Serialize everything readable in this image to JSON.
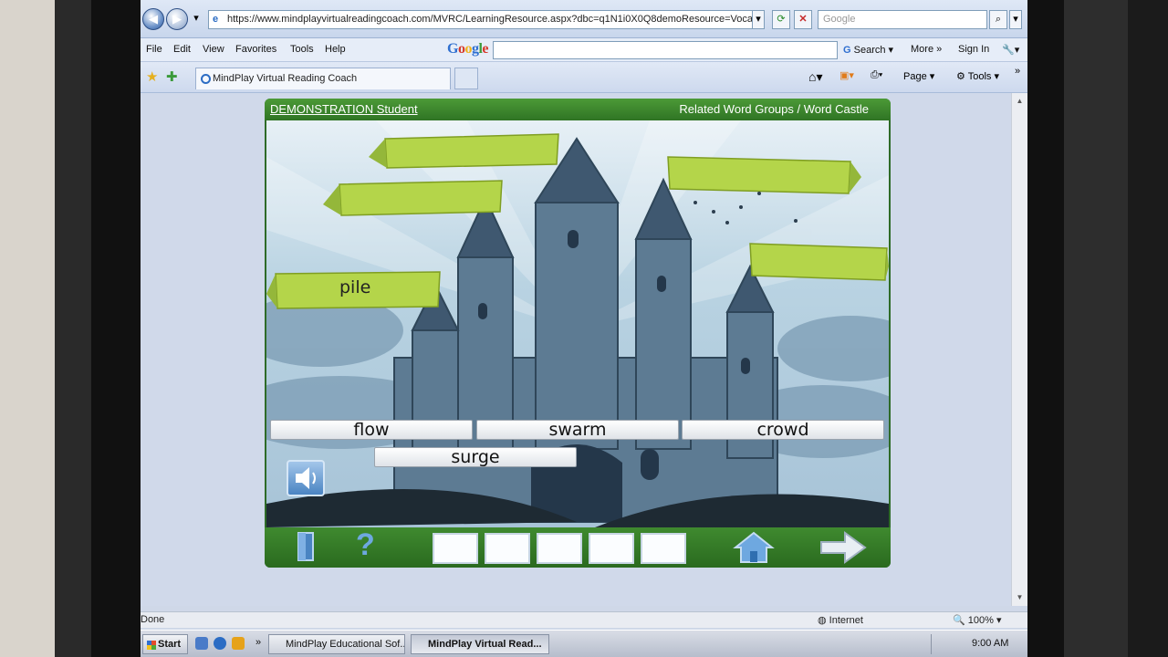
{
  "browser": {
    "address": "https://www.mindplayvirtualreadingcoach.com/MVRC/LearningResource.aspx?dbc=q1N1i0X0Q8demoResource=Vocab",
    "search_placeholder": "Google",
    "menu": [
      "File",
      "Edit",
      "View",
      "Favorites",
      "Tools",
      "Help"
    ],
    "google_label": "Google",
    "google_search_label": "Search",
    "more_label": "More",
    "sign_in_label": "Sign In",
    "tab_title": "MindPlay Virtual Reading Coach",
    "page_label": "Page",
    "tools_label": "Tools"
  },
  "app": {
    "student_label": "DEMONSTRATION Student",
    "breadcrumb": "Related Word Groups / Word Castle",
    "target_word": "pile",
    "word_choices": [
      "flow",
      "swarm",
      "crowd",
      "surge"
    ],
    "answer_slots": 5
  },
  "status": {
    "text": "Done",
    "zone": "Internet",
    "zoom": "100%"
  },
  "taskbar": {
    "start_label": "Start",
    "tasks": [
      "MindPlay Educational Sof...",
      "MindPlay Virtual Read..."
    ],
    "clock": "9:00 AM"
  }
}
